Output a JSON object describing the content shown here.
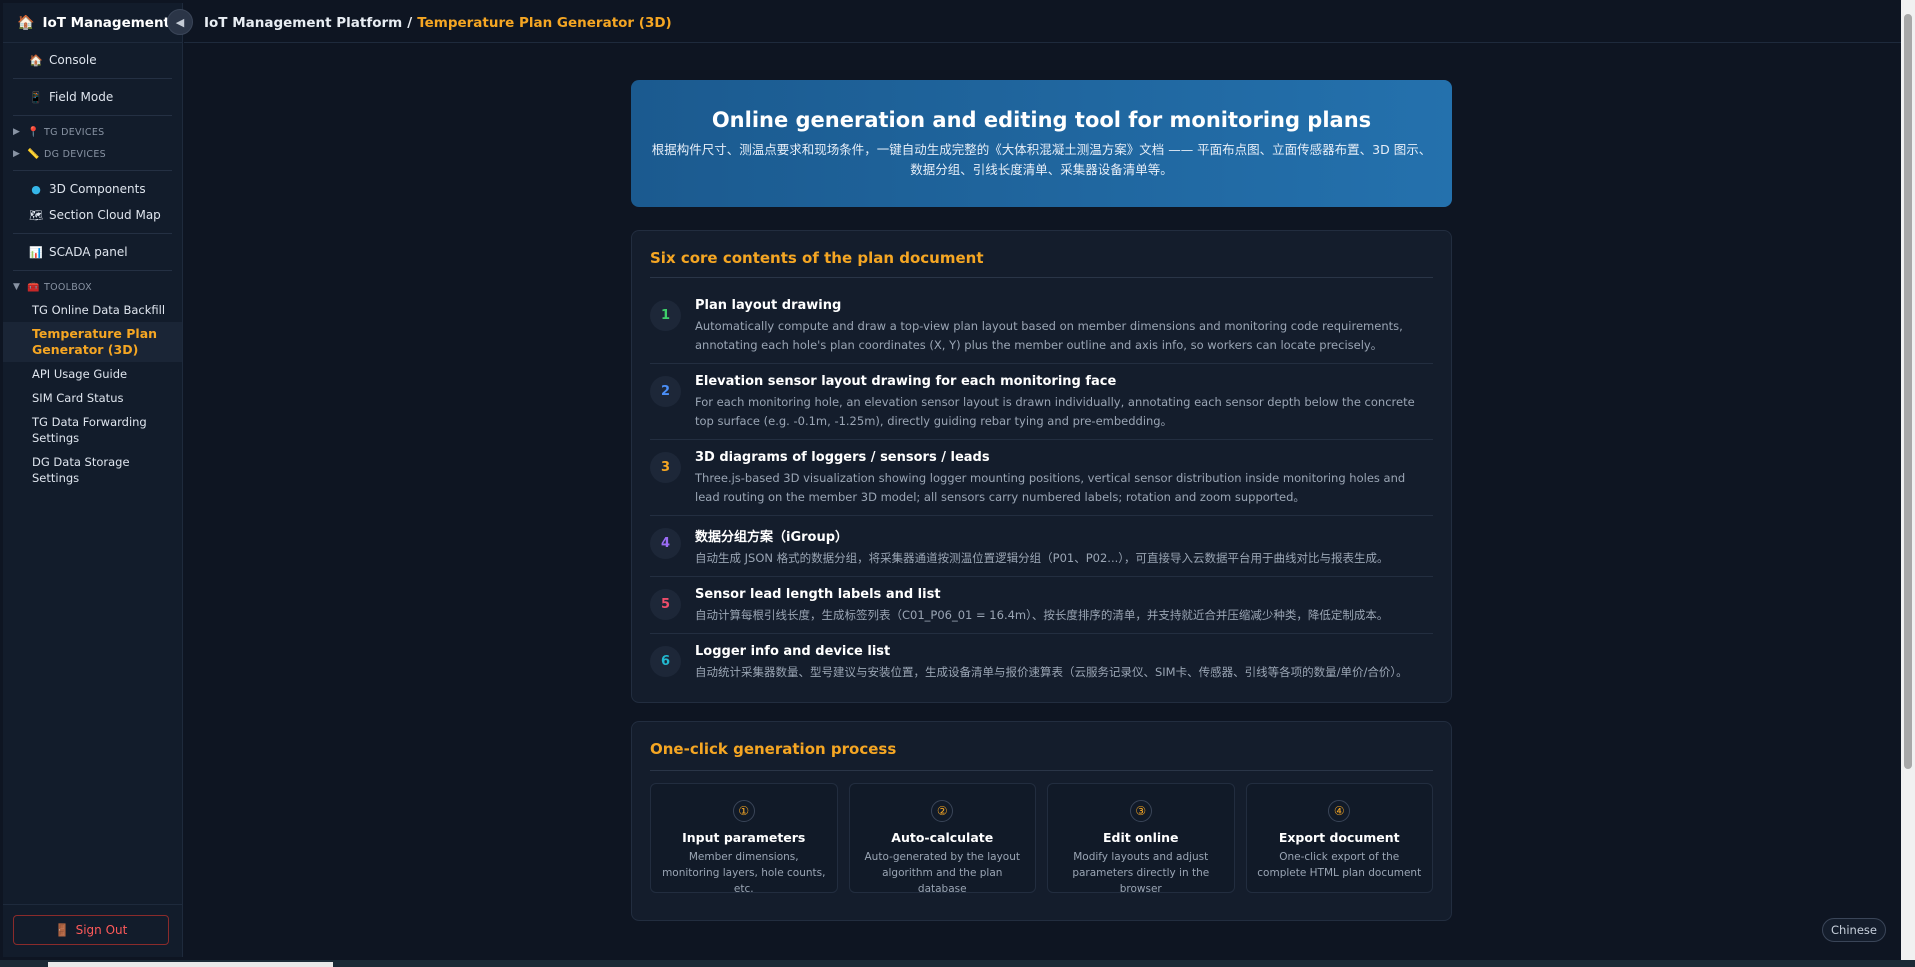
{
  "app": {
    "brand": "IoT Management Plat",
    "collapse_icon": "◀"
  },
  "breadcrumb": {
    "root": "IoT Management Platform",
    "separator": "/",
    "current": "Temperature Plan Generator (3D)"
  },
  "sidebar": {
    "top_items": [
      {
        "label": "Console",
        "icon": "home-icon",
        "glyph": "🏠"
      },
      {
        "label": "Field Mode",
        "icon": "phone-icon",
        "glyph": "📱"
      }
    ],
    "groups": [
      {
        "label": "TG DEVICES",
        "icon": "pin-icon",
        "glyph": "📍",
        "expanded": false
      },
      {
        "label": "DG DEVICES",
        "icon": "ruler-icon",
        "glyph": "📏",
        "expanded": false
      }
    ],
    "mid_items": [
      {
        "label": "3D Components",
        "icon": "globe-icon",
        "glyph": "🔵"
      },
      {
        "label": "Section Cloud Map",
        "icon": "map-icon",
        "glyph": "🗺"
      }
    ],
    "scada": {
      "label": "SCADA panel",
      "icon": "chart-icon",
      "glyph": "📊"
    },
    "toolbox": {
      "label": "TOOLBOX",
      "glyph": "🧰",
      "items": [
        {
          "label": "TG Online Data Backfill",
          "active": false
        },
        {
          "label": "Temperature Plan Generator (3D)",
          "active": true
        },
        {
          "label": "API Usage Guide",
          "active": false
        },
        {
          "label": "SIM Card Status",
          "active": false
        },
        {
          "label": "TG Data Forwarding Settings",
          "active": false
        },
        {
          "label": "DG Data Storage Settings",
          "active": false
        }
      ]
    },
    "signout": {
      "label": "Sign Out",
      "glyph": "🚪"
    }
  },
  "hero": {
    "title": "Online generation and editing tool for monitoring plans",
    "description": "根据构件尺寸、测温点要求和现场条件，一键自动生成完整的《大体积混凝土测温方案》文档 —— 平面布点图、立面传感器布置、3D 图示、数据分组、引线长度清单、采集器设备清单等。"
  },
  "core": {
    "title": "Six core contents of the plan document",
    "items": [
      {
        "num": "1",
        "color": "#3ecf6a",
        "title": "Plan layout drawing",
        "text": "Automatically compute and draw a top-view plan layout based on member dimensions and monitoring code requirements, annotating each hole's plan coordinates (X, Y) plus the member outline and axis info, so workers can locate precisely。"
      },
      {
        "num": "2",
        "color": "#4b8ff7",
        "title": "Elevation sensor layout drawing for each monitoring face",
        "text": "For each monitoring hole, an elevation sensor layout is drawn individually, annotating each sensor depth below the concrete top surface (e.g. -0.1m, -1.25m), directly guiding rebar tying and pre-embedding。"
      },
      {
        "num": "3",
        "color": "#f5a623",
        "title": "3D diagrams of loggers / sensors / leads",
        "text": "Three.js-based 3D visualization showing logger mounting positions, vertical sensor distribution inside monitoring holes and lead routing on the member 3D model; all sensors carry numbered labels; rotation and zoom supported。"
      },
      {
        "num": "4",
        "color": "#9b6cf5",
        "title": "数据分组方案（iGroup）",
        "text": "自动生成 JSON 格式的数据分组，将采集器通道按测温位置逻辑分组（P01、P02...），可直接导入云数据平台用于曲线对比与报表生成。"
      },
      {
        "num": "5",
        "color": "#ef4d6a",
        "title": "Sensor lead length labels and list",
        "text": "自动计算每根引线长度，生成标签列表（C01_P06_01 = 16.4m）、按长度排序的清单，并支持就近合并压缩减少种类，降低定制成本。"
      },
      {
        "num": "6",
        "color": "#22b8cf",
        "title": "Logger info and device list",
        "text": "自动统计采集器数量、型号建议与安装位置，生成设备清单与报价速算表（云服务记录仪、SIM卡、传感器、引线等各项的数量/单价/合价）。"
      }
    ]
  },
  "process": {
    "title": "One-click generation process",
    "steps": [
      {
        "num": "①",
        "title": "Input parameters",
        "text": "Member dimensions, monitoring layers, hole counts, etc."
      },
      {
        "num": "②",
        "title": "Auto-calculate",
        "text": "Auto-generated by the layout algorithm and the plan database"
      },
      {
        "num": "③",
        "title": "Edit online",
        "text": "Modify layouts and adjust parameters directly in the browser"
      },
      {
        "num": "④",
        "title": "Export document",
        "text": "One-click export of the complete HTML plan document"
      }
    ]
  },
  "language_button": "Chinese"
}
